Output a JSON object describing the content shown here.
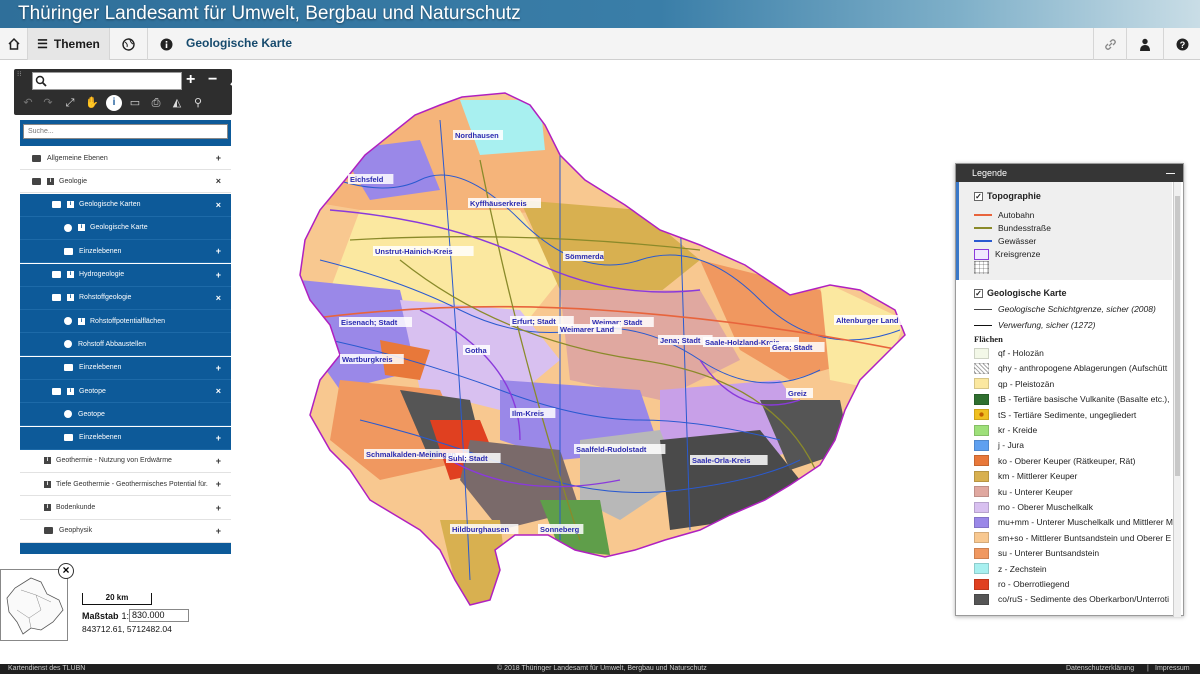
{
  "header": {
    "title": "Thüringer Landesamt für Umwelt, Bergbau und Naturschutz"
  },
  "toolbar": {
    "home_icon": "home-icon",
    "themes_label": "Themen",
    "globe_icon": "globe-icon",
    "info_icon": "info-icon",
    "page_title": "Geologische Karte",
    "link_icon": "link-icon",
    "user_icon": "user-icon",
    "help_icon": "help-icon"
  },
  "map_tools": {
    "search_placeholder": "",
    "zoom_in": "+",
    "zoom_out": "−",
    "collapse": "^"
  },
  "tree": {
    "search_placeholder": "Suche...",
    "items": [
      {
        "label": "Allgemeine Ebenen",
        "toggle": "+"
      },
      {
        "label": "Geologie",
        "toggle": "×"
      },
      {
        "label": "Geologische Karten",
        "toggle": "×"
      },
      {
        "label": "Geologische Karte",
        "toggle": ""
      },
      {
        "label": "Einzelebenen",
        "toggle": "+"
      },
      {
        "label": "Hydrogeologie",
        "toggle": "+"
      },
      {
        "label": "Rohstoffgeologie",
        "toggle": "×"
      },
      {
        "label": "Rohstoffpotentialflächen",
        "toggle": ""
      },
      {
        "label": "Rohstoff Abbaustellen",
        "toggle": ""
      },
      {
        "label": "Einzelebenen",
        "toggle": "+"
      },
      {
        "label": "Geotope",
        "toggle": "×"
      },
      {
        "label": "Geotope",
        "toggle": ""
      },
      {
        "label": "Einzelebenen",
        "toggle": "+"
      },
      {
        "label": "Geothermie - Nutzung von Erdwärme",
        "toggle": "+"
      },
      {
        "label": "Tiefe Geothermie - Geothermisches Potential für.",
        "toggle": "+"
      },
      {
        "label": "Bodenkunde",
        "toggle": "+"
      },
      {
        "label": "Geophysik",
        "toggle": "+"
      }
    ]
  },
  "map_labels": [
    "Nordhausen",
    "Eichsfeld",
    "Kyffhäuserkreis",
    "Unstrut-Hainich-Kreis",
    "Sömmerda",
    "Eisenach; Stadt",
    "Erfurt; Stadt",
    "Weimar; Stadt",
    "Weimarer Land",
    "Jena; Stadt",
    "Saale-Holzland-Kreis",
    "Gera; Stadt",
    "Altenburger Land",
    "Wartburgkreis",
    "Gotha",
    "Ilm-Kreis",
    "Greiz",
    "Schmalkalden-Meiningen",
    "Suhl; Stadt",
    "Saalfeld-Rudolstadt",
    "Saale-Orla-Kreis",
    "Hildburghausen",
    "Sonneberg"
  ],
  "legend": {
    "title": "Legende",
    "topo_title": "Topographie",
    "topo_items": [
      {
        "label": "Autobahn",
        "color": "#e8643c"
      },
      {
        "label": "Bundesstraße",
        "color": "#8a8a2a"
      },
      {
        "label": "Gewässer",
        "color": "#2a5ad0"
      },
      {
        "label": "Kreisgrenze",
        "color": "#8a3adb"
      },
      {
        "label": "",
        "color": "#cccccc"
      }
    ],
    "geo_title": "Geologische Karte",
    "geo_lines": [
      {
        "label": "Geologische Schichtgrenze, sicher (2008)"
      },
      {
        "label": "Verwerfung, sicher (1272)"
      }
    ],
    "flaechen": "Flächen",
    "areas": [
      {
        "label": "qf - Holozän",
        "color": "#f3f8e8"
      },
      {
        "label": "qhy - anthropogene Ablagerungen (Aufschütt",
        "color": "#d0d0d0"
      },
      {
        "label": "qp - Pleistozän",
        "color": "#fbe8a0"
      },
      {
        "label": "tB - Tertiäre basische Vulkanite (Basalte etc.),",
        "color": "#2f6f2f"
      },
      {
        "label": "tS - Tertiäre Sedimente, ungegliedert",
        "color": "#f0c020"
      },
      {
        "label": "kr - Kreide",
        "color": "#9ee07a"
      },
      {
        "label": "j - Jura",
        "color": "#5fa0f0"
      },
      {
        "label": "ko - Oberer Keuper (Rätkeuper, Rät)",
        "color": "#e8783a"
      },
      {
        "label": "km - Mittlerer Keuper",
        "color": "#d8b050"
      },
      {
        "label": "ku - Unterer Keuper",
        "color": "#e0a8a0"
      },
      {
        "label": "mo - Oberer Muschelkalk",
        "color": "#d8c0f0"
      },
      {
        "label": "mu+mm - Unterer Muschelkalk und Mittlerer M",
        "color": "#9a88e8"
      },
      {
        "label": "sm+so - Mittlerer Buntsandstein und Oberer E",
        "color": "#f8c890"
      },
      {
        "label": "su - Unterer Buntsandstein",
        "color": "#f09860"
      },
      {
        "label": "z - Zechstein",
        "color": "#a8f0f0"
      },
      {
        "label": "ro - Oberrotliegend",
        "color": "#e04020"
      },
      {
        "label": "co/ruS - Sedimente des Oberkarbon/Unterroti",
        "color": "#555555"
      }
    ]
  },
  "scale": {
    "bar_label": "20 km",
    "label": "Maßstab",
    "prefix": "1:",
    "value": "830.000",
    "coords": "843712.61, 5712482.04"
  },
  "footer": {
    "left": "Kartendienst des TLUBN",
    "center": "© 2018 Thüringer Landesamt für Umwelt, Bergbau und Naturschutz",
    "privacy": "Datenschutzerklärung",
    "sep": "|",
    "imprint": "Impressum"
  }
}
